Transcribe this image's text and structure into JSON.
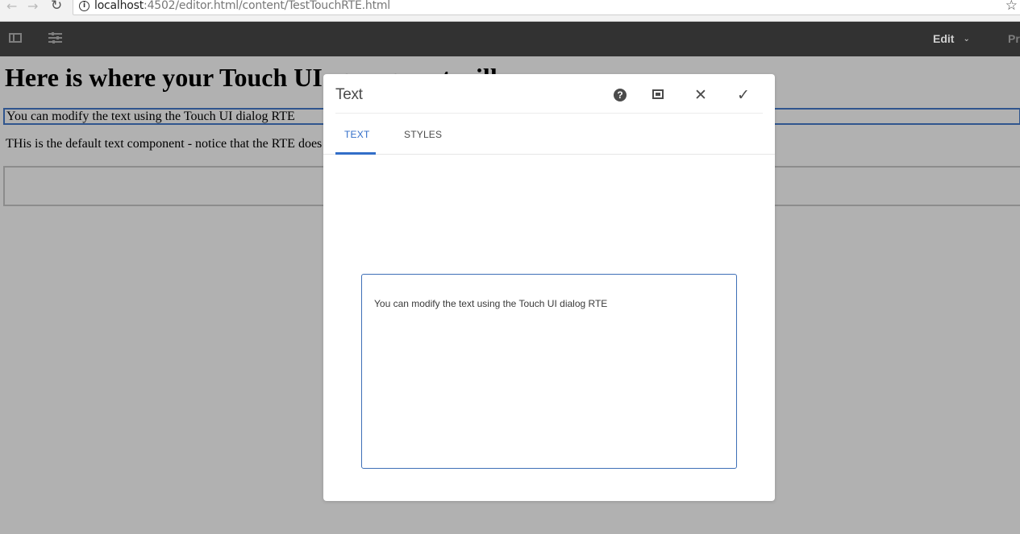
{
  "browser": {
    "back_glyph": "←",
    "forward_glyph": "→",
    "reload_glyph": "↻",
    "url_host": "localhost",
    "url_path": ":4502/editor.html/content/TestTouchRTE.html",
    "bookmark_glyph": "☆"
  },
  "toolbar": {
    "mode_label": "Edit",
    "mode_chevron": "⌄",
    "preview_label": "Pr"
  },
  "page": {
    "heading": "Here is where your Touch UI component will",
    "text_component_1": "You can modify the text using the Touch UI dialog RTE",
    "text_component_2": "THis is the default text component - notice that the RTE does"
  },
  "dialog": {
    "title": "Text",
    "help_glyph": "?",
    "close_glyph": "✕",
    "done_glyph": "✓",
    "tabs": [
      {
        "label": "TEXT",
        "active": true
      },
      {
        "label": "STYLES",
        "active": false
      }
    ],
    "rte_value": "You can modify the text using the Touch UI dialog RTE"
  },
  "colors": {
    "overlay": "#b1b1b1",
    "toolbar_bg": "#323232",
    "accent": "#326ec8"
  }
}
